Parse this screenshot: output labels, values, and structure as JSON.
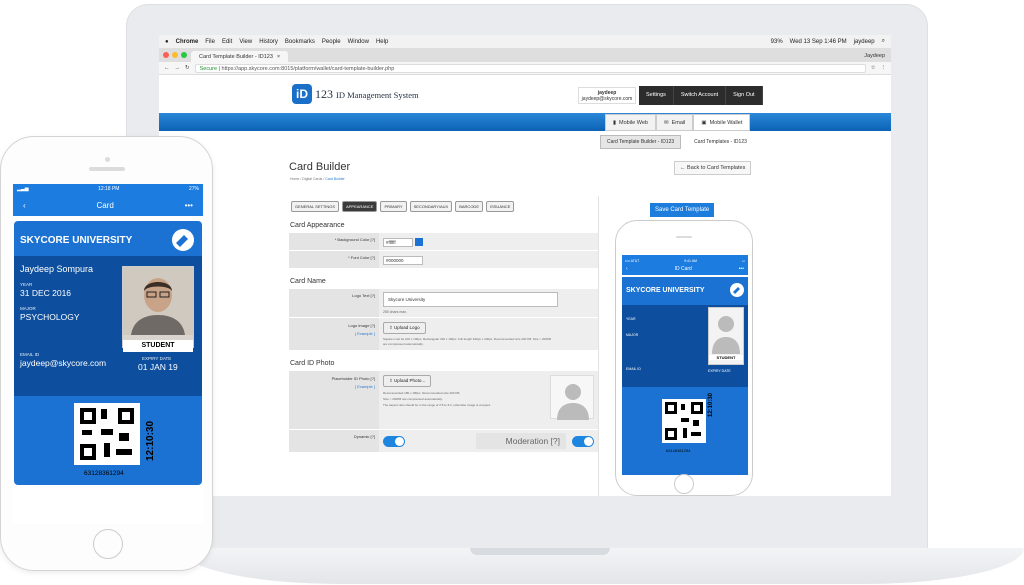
{
  "os_menu": {
    "apple": "",
    "app": "Chrome",
    "items": [
      "File",
      "Edit",
      "View",
      "History",
      "Bookmarks",
      "People",
      "Window",
      "Help"
    ],
    "status": "93%",
    "clock": "Wed 13 Sep 1:46 PM",
    "user": "jaydeep"
  },
  "browser": {
    "tab_title": "Card Template Builder - ID123",
    "profile": "Jaydeep",
    "secure": "Secure",
    "url": "https://app.skycore.com:8015/platform/wallet/card-template-builder.php"
  },
  "site": {
    "logo_badge": "iD",
    "logo_num": "123",
    "logo_name": "ID Management System",
    "user_name": "jaydeep",
    "user_email": "jaydeep@skycore.com",
    "nav": [
      "Settings",
      "Switch Account",
      "Sign Out"
    ],
    "channels": [
      "Mobile Web",
      "Email",
      "Mobile Wallet"
    ],
    "subtabs": [
      "Card Template Builder - ID123",
      "Card Templates - ID123"
    ],
    "title": "Card Builder",
    "breadcrumb_1": "Home",
    "breadcrumb_2": "Digital Cards",
    "breadcrumb_3": "Card Builder",
    "back": "Back to Card Templates",
    "save": "Save Card Template"
  },
  "form": {
    "tabs": [
      "GENERAL SETTINGS",
      "APPEARANCE",
      "PRIMARY",
      "SECONDARY/AUX",
      "BARCODE",
      "ISSUANCE"
    ],
    "appearance_title": "Card Appearance",
    "bg_label": "* Background Color [?]",
    "bg_val": "#ffffff",
    "font_label": "* Font Color [?]",
    "font_val": "#000000",
    "cardname_title": "Card Name",
    "logo_text_label": "Logo Text [?]",
    "logo_text_val": "Skycore University",
    "logo_text_hint": "250 chars max.",
    "logo_image_label": "Logo Image [?]",
    "example": "[ Example ]",
    "upload_logo": "Upload Logo",
    "logo_hint": "Square must be 100 x 100px. Rectangular 320 x 100px. Full length 640px x 100px. Recommended size 200 KB. Size > 200KB are compressed automatically.",
    "photo_title": "Card ID Photo",
    "photo_label": "Placeholder ID Photo [?]",
    "upload_photo": "Upload Photo...",
    "photo_hint1": "Recommended 180 x 180px. Recommended size 200 KB.",
    "photo_hint2": "Size > 200KB are compressed automatically.",
    "photo_hint3": "The aspect ratio should be in the range of 2:5 to 3:2, otherwise image is cropped.",
    "dynamic_label": "Dynamic [?]",
    "moderation_label": "Moderation [?]"
  },
  "small_phone": {
    "carrier": "•••• AT&T",
    "time": "9:41 AM",
    "title": "ID Card",
    "univ": "SKYCORE UNIVERSITY",
    "f1": "YEAR",
    "f2": "MAJOR",
    "f3": "EMAIL ID",
    "f4": "EXPIRY DATE",
    "badge": "STUDENT",
    "clock": "12:10:30",
    "number": "63126361294"
  },
  "large_phone": {
    "time": "12:18 PM",
    "battery": "27%",
    "nav_title": "Card",
    "univ": "SKYCORE UNIVERSITY",
    "name": "Jaydeep Sompura",
    "year_label": "YEAR",
    "year": "31 DEC 2016",
    "major_label": "MAJOR",
    "major": "PSYCHOLOGY",
    "email_label": "EMAIL ID",
    "email": "jaydeep@skycore.com",
    "expiry_label": "EXPIRY DATE",
    "expiry": "01 JAN 19",
    "badge": "STUDENT",
    "clock": "12:10:30",
    "number": "63128361294"
  },
  "colors": {
    "brand": "#1c72d2",
    "dark_card": "#0d4f9e",
    "toggle": "#1f86e0"
  }
}
